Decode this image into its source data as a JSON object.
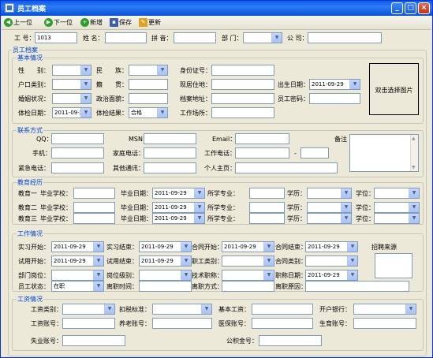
{
  "window": {
    "title": "员工档案"
  },
  "toolbar": {
    "prev": "上一位",
    "next": "下一位",
    "add": "新增",
    "save": "保存",
    "update": "更新"
  },
  "top": {
    "id_label": "工 号：",
    "id_value": "1013",
    "name_label": "姓 名：",
    "pinyin_label": "拼 音：",
    "dept_label": "部 门：",
    "company_label": "公 司："
  },
  "archive": {
    "title": "员工档案"
  },
  "basic": {
    "title": "基本情况",
    "gender": "性　　别：",
    "ethnic": "民　　族：",
    "idcard": "身份证号：",
    "hukou": "户口类别：",
    "native": "籍　　贯：",
    "residence": "现居住地：",
    "birth": "出生日期：",
    "birth_value": "2011-09-29",
    "marital": "婚姻状况：",
    "political": "政治面貌：",
    "archive_addr": "档案地址：",
    "password": "员工密码：",
    "exam_date": "体检日期：",
    "exam_date_value": "2011-09-29",
    "exam_result": "体检结果：",
    "exam_result_value": "合格",
    "workplace": "工作场所：",
    "photo": "双击选择图片"
  },
  "contact": {
    "title": "联系方式",
    "qq": "QQ：",
    "msn": "MSN：",
    "email": "Email：",
    "remark": "备注",
    "mobile": "手机：",
    "home": "家庭电话：",
    "work": "工作电话：",
    "dash": "-",
    "emergency": "紧急电话：",
    "other": "其他通讯：",
    "homepage": "个人主页："
  },
  "edu": {
    "title": "教育经历",
    "rows": [
      {
        "no": "教育一",
        "school": "毕业学校：",
        "date": "毕业日期：",
        "date_value": "2011-09-29",
        "major": "所学专业：",
        "degree": "学历：",
        "deg2": "学位："
      },
      {
        "no": "教育二",
        "school": "毕业学校：",
        "date": "毕业日期：",
        "date_value": "2011-09-29",
        "major": "所学专业：",
        "degree": "学历：",
        "deg2": "学位："
      },
      {
        "no": "教育三",
        "school": "毕业学校：",
        "date": "毕业日期：",
        "date_value": "2011-09-29",
        "major": "所学专业：",
        "degree": "学历：",
        "deg2": "学位："
      }
    ]
  },
  "work": {
    "title": "工作情况",
    "intern_start": "实习开始：",
    "intern_end": "实习结束：",
    "contract_start": "合同开始：",
    "contract_end": "合同结束：",
    "recruit": "招聘来源",
    "probation_start": "试用开始：",
    "probation_end": "试用结束：",
    "job_type": "职工类别：",
    "contract_type": "合同类别：",
    "position": "部门岗位：",
    "level": "岗位级别：",
    "tech_title": "技术职称：",
    "title_date": "职称日期：",
    "status": "员工状态：",
    "status_value": "在职",
    "leave_time": "离职时间：",
    "leave_way": "离职方式：",
    "leave_reason": "离职原因：",
    "date_value": "2011-09-29"
  },
  "salary": {
    "title": "工资情况",
    "wage_type": "工资类别：",
    "tax": "扣税标准：",
    "base": "基本工资：",
    "bank": "开户银行：",
    "wage_acct": "工资账号：",
    "pension": "养老账号：",
    "medical": "医保账号：",
    "maternity": "生育账号：",
    "unemploy": "失业账号：",
    "housing": "公积金号："
  },
  "colors": {
    "title_blue": "#0a5ee8",
    "group_title": "#0046d5",
    "window_bg": "#ece9d8"
  }
}
